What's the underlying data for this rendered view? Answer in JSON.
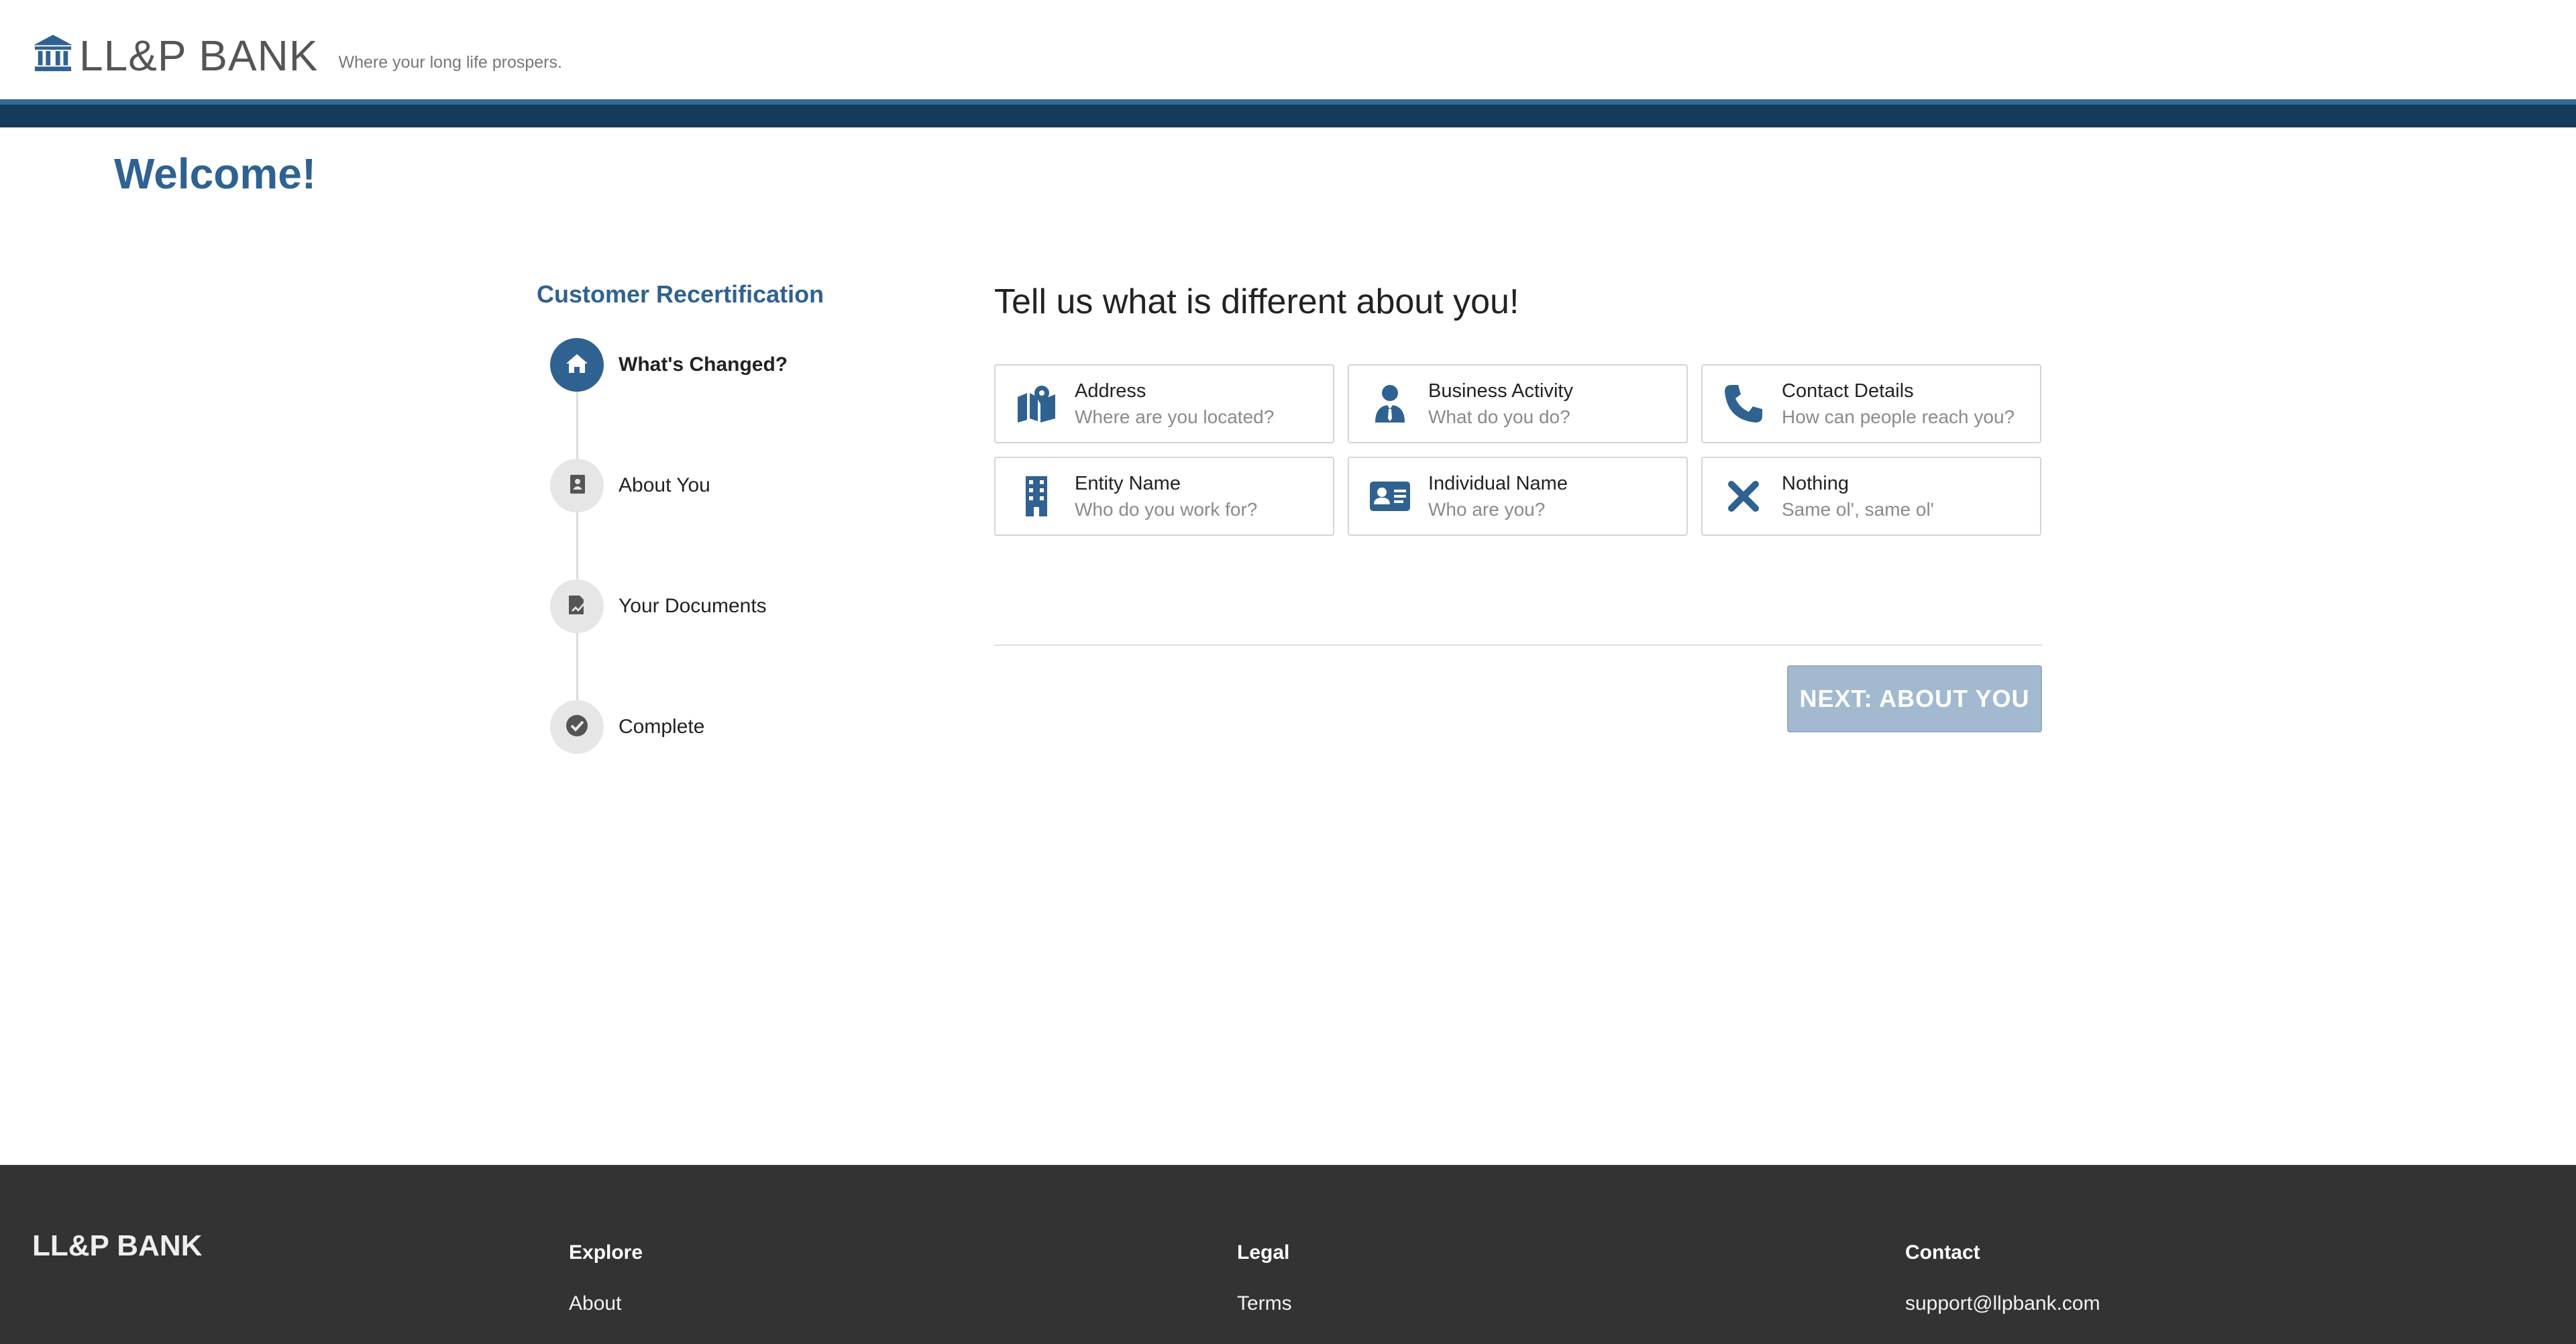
{
  "header": {
    "brand_name": "LL&P BANK",
    "tagline": "Where your long life prospers.",
    "brand_icon": "bank-icon"
  },
  "welcome": "Welcome!",
  "stepper": {
    "title": "Customer Recertification",
    "steps": [
      {
        "label": "What's Changed?",
        "icon": "home-icon",
        "active": true
      },
      {
        "label": "About You",
        "icon": "contact-book-icon",
        "active": false
      },
      {
        "label": "Your Documents",
        "icon": "document-sign-icon",
        "active": false
      },
      {
        "label": "Complete",
        "icon": "check-circle-icon",
        "active": false
      }
    ]
  },
  "main": {
    "title": "Tell us what is different about you!",
    "options": [
      {
        "title": "Address",
        "subtitle": "Where are you located?",
        "icon": "map-location-icon"
      },
      {
        "title": "Business Activity",
        "subtitle": "What do you do?",
        "icon": "businessman-icon"
      },
      {
        "title": "Contact Details",
        "subtitle": "How can people reach you?",
        "icon": "phone-icon"
      },
      {
        "title": "Entity Name",
        "subtitle": "Who do you work for?",
        "icon": "building-icon"
      },
      {
        "title": "Individual Name",
        "subtitle": "Who are you?",
        "icon": "id-card-icon"
      },
      {
        "title": "Nothing",
        "subtitle": "Same ol', same ol'",
        "icon": "x-icon"
      }
    ],
    "next_label": "NEXT: ABOUT YOU"
  },
  "footer": {
    "brand": "LL&P BANK",
    "columns": [
      {
        "title": "Explore",
        "link": "About"
      },
      {
        "title": "Legal",
        "link": "Terms"
      },
      {
        "title": "Contact",
        "link": "support@llpbank.com"
      }
    ]
  },
  "colors": {
    "primary": "#2f6290",
    "band_dark": "#143b5c",
    "button_disabled": "#a2b9cf",
    "footer_bg": "#333333"
  }
}
